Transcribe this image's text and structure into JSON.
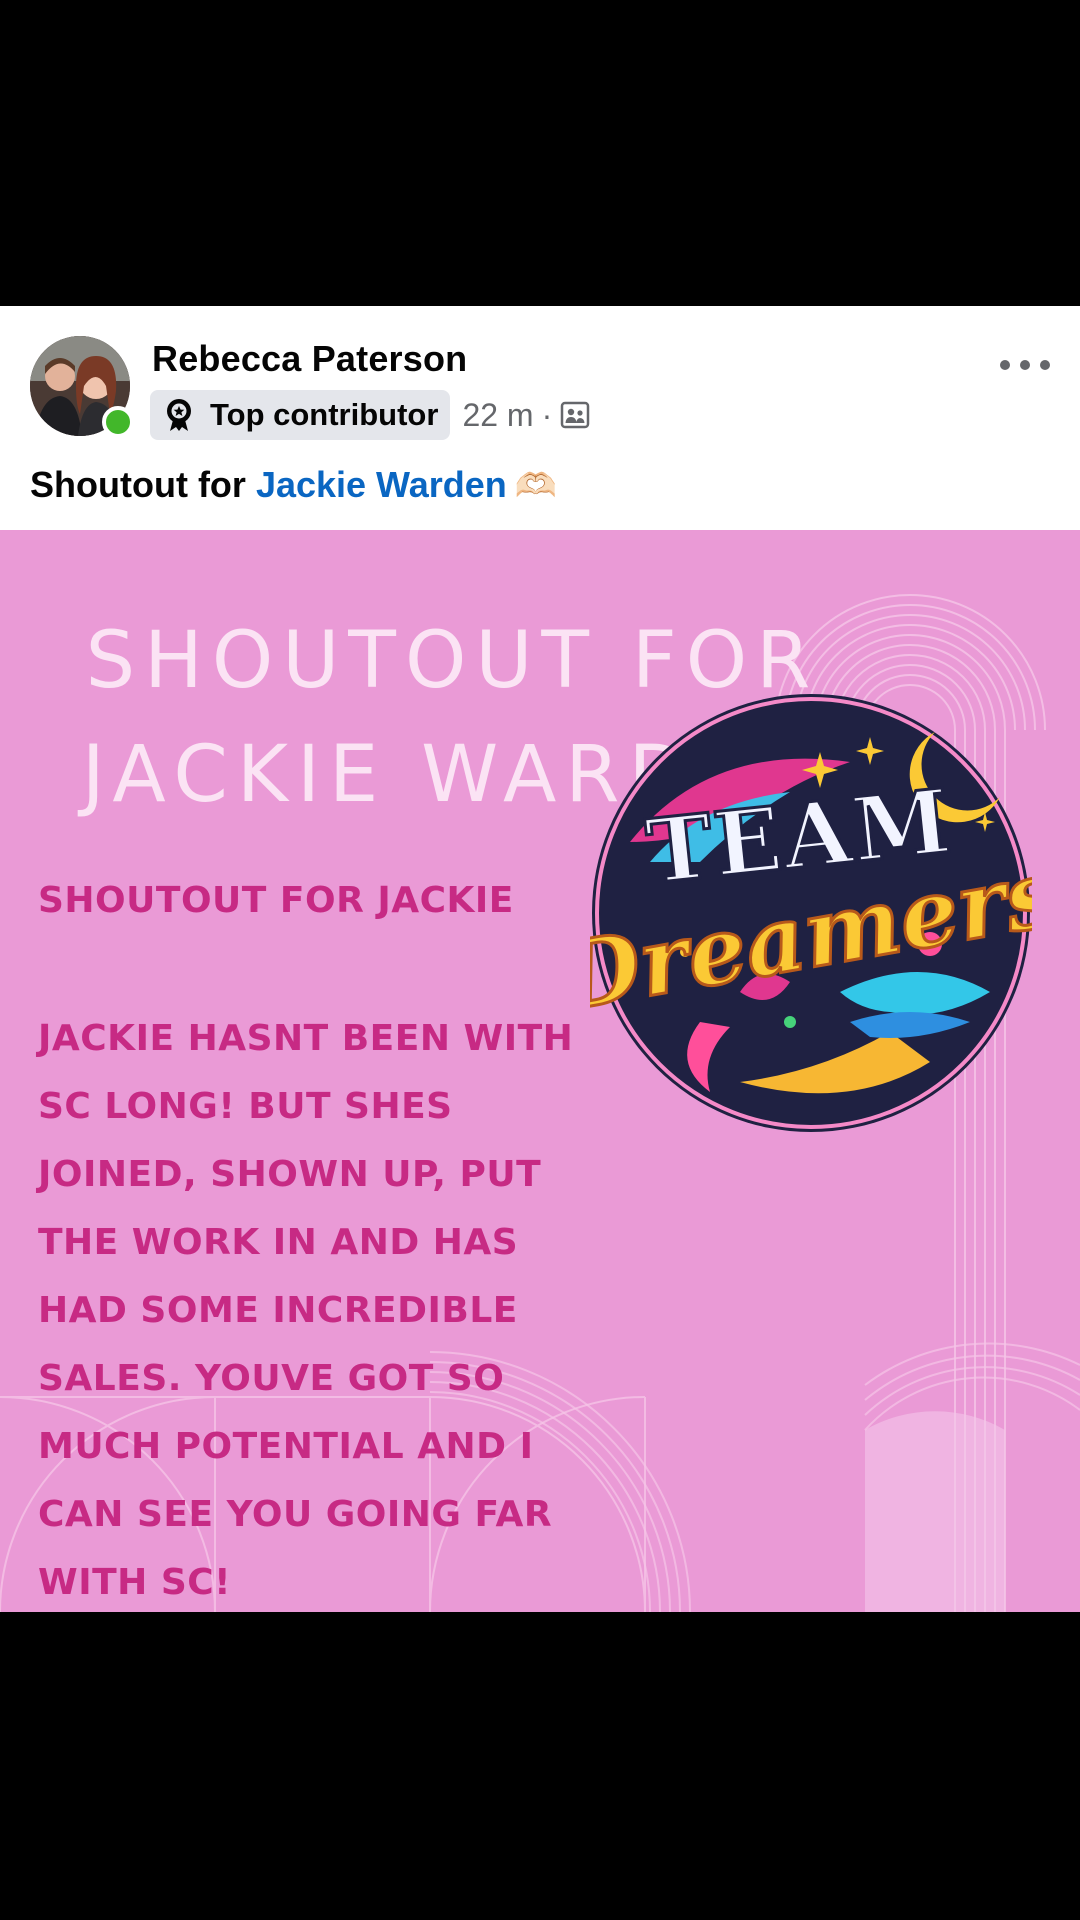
{
  "post": {
    "author": "Rebecca Paterson",
    "badge_label": "Top contributor",
    "time": "22 m",
    "separator": "·",
    "caption_prefix": "Shoutout for ",
    "caption_mention": "Jackie Warden",
    "caption_emoji": "🫶🏻"
  },
  "graphic": {
    "title_line1": "SHOUTOUT FOR",
    "title_line2": "JACKIE WARDEN",
    "heading": "SHOUTOUT FOR JACKIE",
    "body_lines": [
      "JACKIE HASNT BEEN WITH",
      "SC LONG! BUT SHES",
      "JOINED, SHOWN UP, PUT",
      "THE WORK IN AND HAS",
      "HAD SOME INCREDIBLE",
      "SALES. YOUVE GOT SO",
      "MUCH POTENTIAL AND I",
      "CAN SEE YOU GOING FAR",
      "WITH SC!"
    ],
    "logo_line1": "TEAM",
    "logo_line2": "Dreamers"
  },
  "icons": {
    "badge": "award-icon",
    "audience": "group-icon",
    "more": "more-options-icon"
  },
  "colors": {
    "graphic_bg": "#ea9ad6",
    "title_text": "#fbe3f4",
    "body_text": "#c72a84",
    "mention": "#0a66c2",
    "online": "#42b72a"
  }
}
